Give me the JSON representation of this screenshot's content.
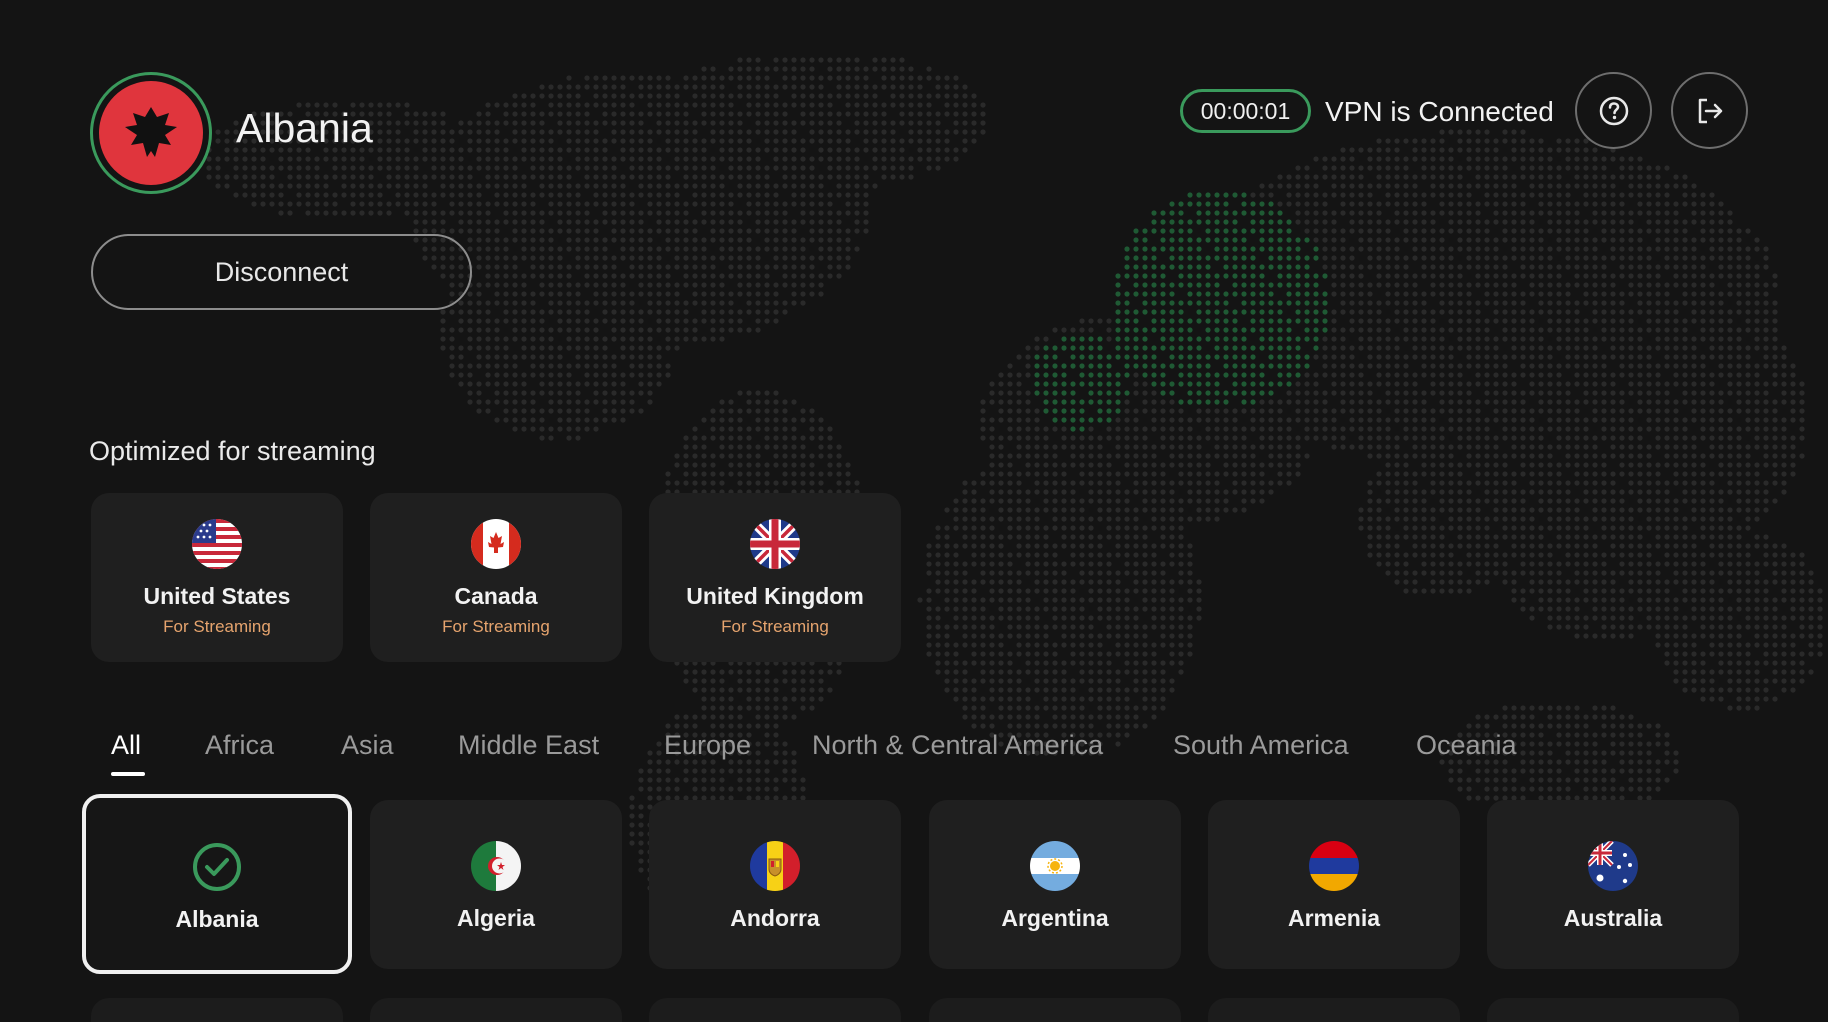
{
  "current_location": {
    "country": "Albania",
    "flag_icon": "albania-flag-icon"
  },
  "actions": {
    "disconnect_label": "Disconnect"
  },
  "status": {
    "timer": "00:00:01",
    "text": "VPN is Connected",
    "accent_color": "#3a9a5c"
  },
  "header_buttons": {
    "help_icon": "question-circle-icon",
    "logout_icon": "logout-arrow-icon"
  },
  "streaming": {
    "title": "Optimized for streaming",
    "items": [
      {
        "name": "United States",
        "subtitle": "For Streaming",
        "flag": "us-flag-icon"
      },
      {
        "name": "Canada",
        "subtitle": "For Streaming",
        "flag": "canada-flag-icon"
      },
      {
        "name": "United Kingdom",
        "subtitle": "For Streaming",
        "flag": "uk-flag-icon"
      }
    ]
  },
  "tabs": [
    {
      "label": "All",
      "active": true
    },
    {
      "label": "Africa"
    },
    {
      "label": "Asia"
    },
    {
      "label": "Middle East"
    },
    {
      "label": "Europe"
    },
    {
      "label": "North & Central America"
    },
    {
      "label": "South America"
    },
    {
      "label": "Oceania"
    }
  ],
  "countries": [
    {
      "name": "Albania",
      "selected": true,
      "flag": "check-circle-icon"
    },
    {
      "name": "Algeria",
      "flag": "algeria-flag-icon"
    },
    {
      "name": "Andorra",
      "flag": "andorra-flag-icon"
    },
    {
      "name": "Argentina",
      "flag": "argentina-flag-icon"
    },
    {
      "name": "Armenia",
      "flag": "armenia-flag-icon"
    },
    {
      "name": "Australia",
      "flag": "australia-flag-icon"
    }
  ],
  "colors": {
    "background": "#141414",
    "card": "#1f1f1f",
    "streaming_subtitle": "#e6a46e",
    "map_dots": "#2a2a2a",
    "map_highlight": "#1f5a34"
  }
}
